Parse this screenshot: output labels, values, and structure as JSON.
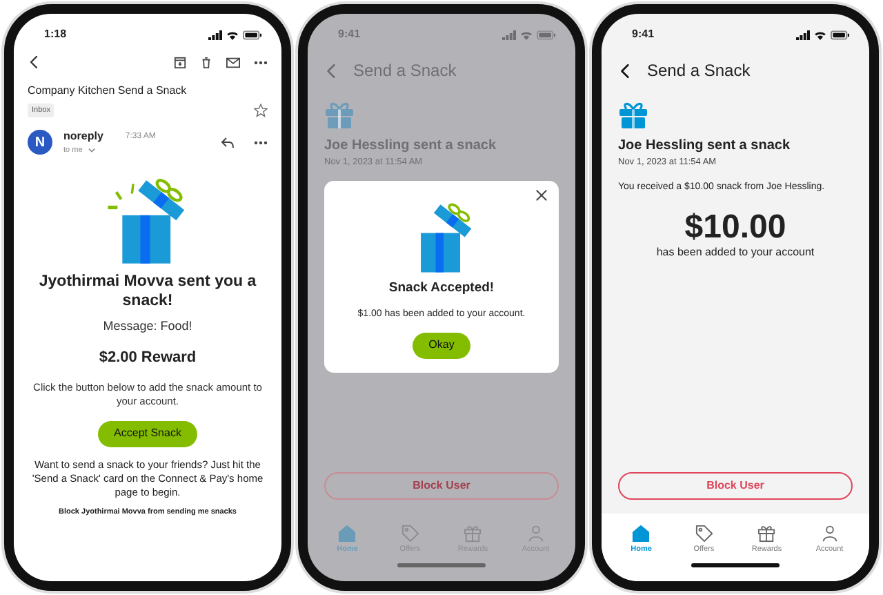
{
  "screens": [
    {
      "kind": "email",
      "status_bar": {
        "time": "1:18"
      },
      "subject": "Company Kitchen Send a Snack",
      "label": "Inbox",
      "starred": false,
      "sender": {
        "avatar": "N",
        "name": "noreply",
        "time": "7:33 AM",
        "recipient": "to me"
      },
      "heading": "Jyothirmai Movva sent you a snack!",
      "message": "Message: Food!",
      "reward": "$2.00 Reward",
      "instructions": "Click the button below to add the snack amount to your account.",
      "button": "Accept Snack",
      "footer": "Want to send a snack to your friends? Just hit the 'Send a Snack' card on the Connect & Pay's home page to begin.",
      "block_link": "Block Jyothirmai Movva from sending me snacks"
    },
    {
      "kind": "app",
      "dimmed": true,
      "status_bar": {
        "time": "9:41"
      },
      "title": "Send a Snack",
      "sender_line": "Joe Hessling sent a snack",
      "date": "Nov 1, 2023 at 11:54 AM",
      "modal": {
        "title": "Snack Accepted!",
        "text": "$1.00 has been added to your account.",
        "button": "Okay"
      },
      "block_button": "Block User",
      "tabs": [
        {
          "label": "Home",
          "kind": "home",
          "selected": true
        },
        {
          "label": "Offers",
          "kind": "offers",
          "selected": false
        },
        {
          "label": "Rewards",
          "kind": "rewards",
          "selected": false
        },
        {
          "label": "Account",
          "kind": "account",
          "selected": false
        }
      ]
    },
    {
      "kind": "app",
      "dimmed": false,
      "status_bar": {
        "time": "9:41"
      },
      "title": "Send a Snack",
      "sender_line": "Joe Hessling sent a snack",
      "date": "Nov 1, 2023 at 11:54 AM",
      "received": "You received a $10.00 snack from Joe Hessling.",
      "amount": "$10.00",
      "amount_note": "has been added to your account",
      "block_button": "Block User",
      "tabs": [
        {
          "label": "Home",
          "kind": "home",
          "selected": true
        },
        {
          "label": "Offers",
          "kind": "offers",
          "selected": false
        },
        {
          "label": "Rewards",
          "kind": "rewards",
          "selected": false
        },
        {
          "label": "Account",
          "kind": "account",
          "selected": false
        }
      ]
    }
  ]
}
